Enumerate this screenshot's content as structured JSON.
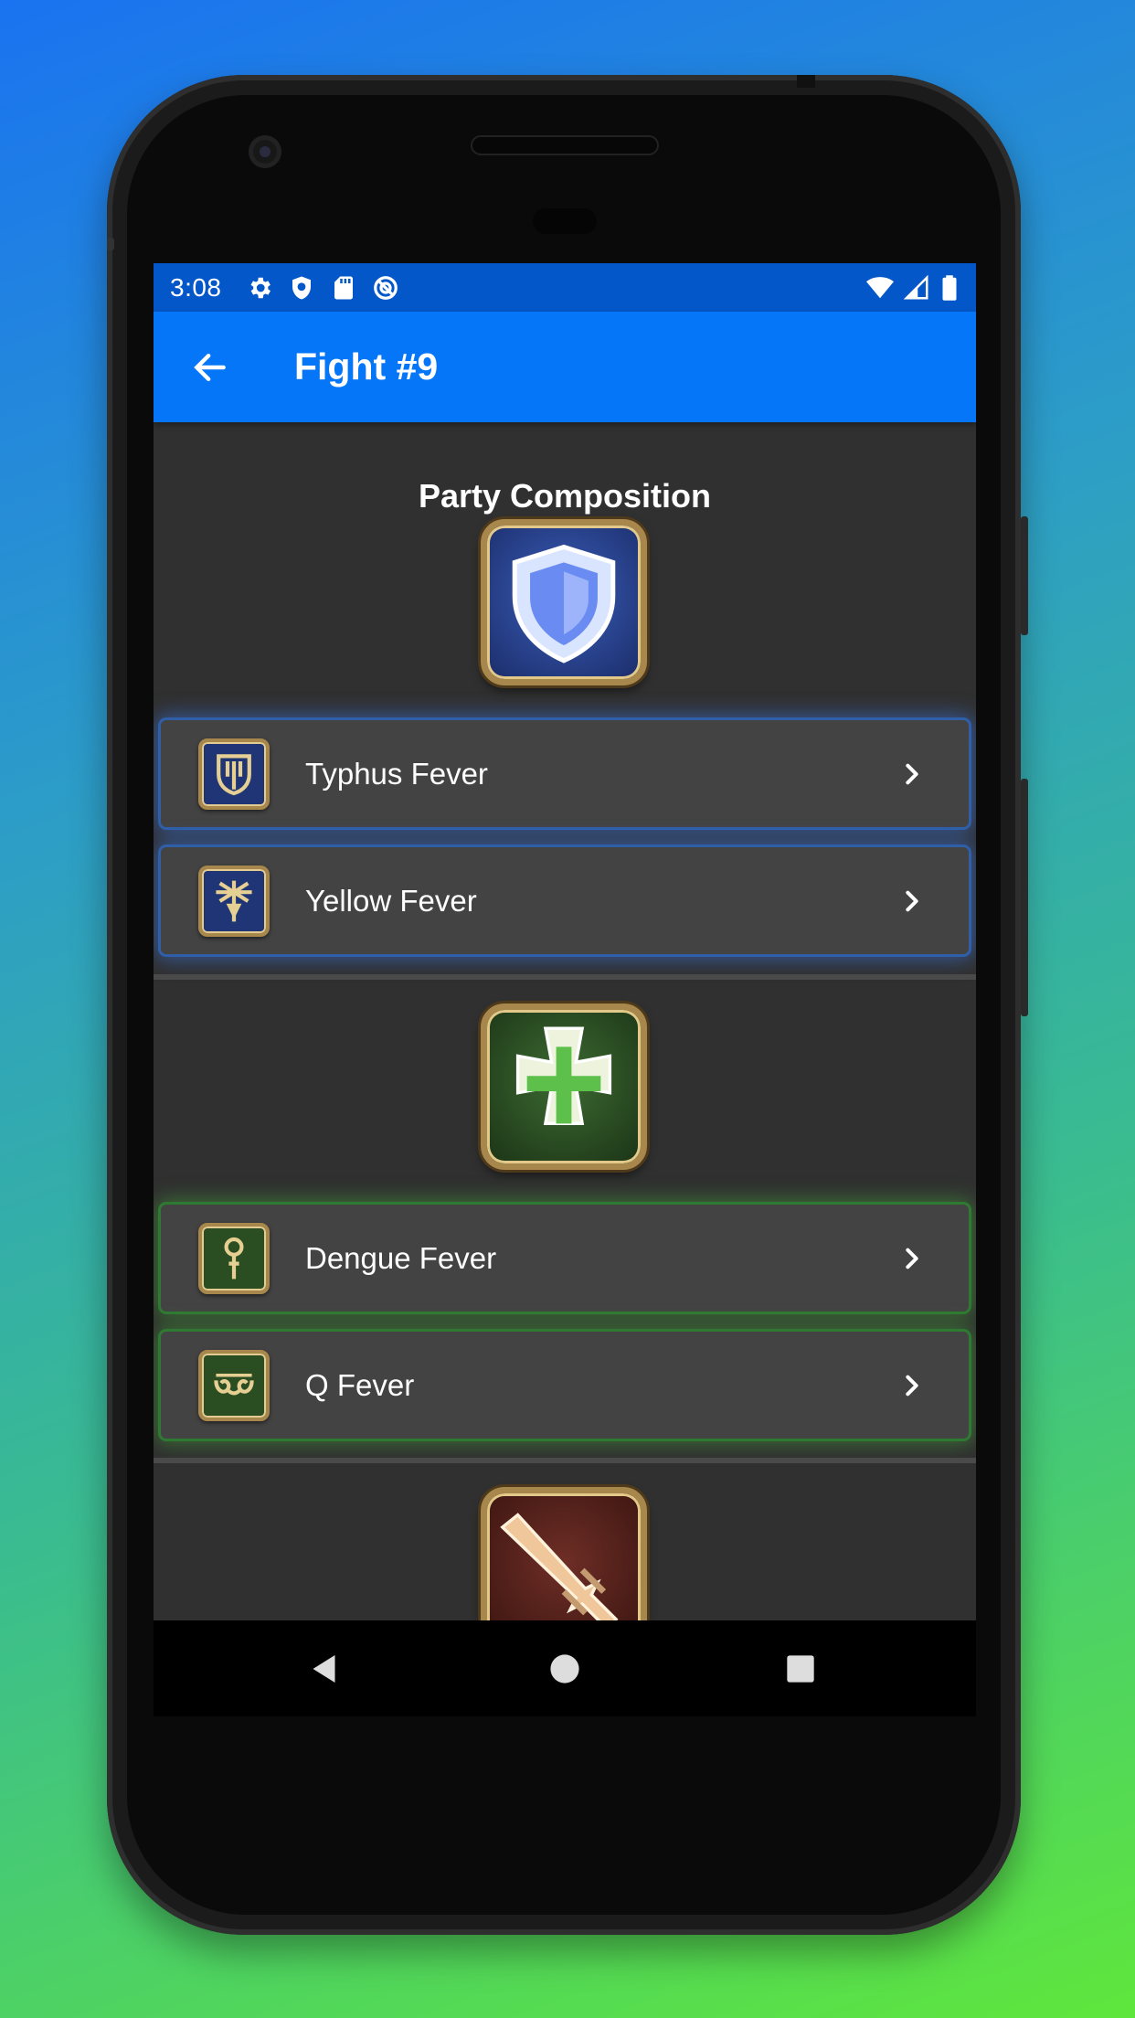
{
  "status_bar": {
    "time": "3:08",
    "left_icons": [
      "settings-icon",
      "shield-icon",
      "sd-card-icon",
      "sync-icon"
    ],
    "right_icons": [
      "wifi-icon",
      "cell-signal-icon",
      "battery-icon"
    ]
  },
  "app_bar": {
    "title": "Fight #9",
    "back_icon": "arrow-back-icon"
  },
  "section_title": "Party Composition",
  "roles": [
    {
      "role": "tank",
      "role_icon": "shield-role-icon",
      "color": "#2f5fa8",
      "members": [
        {
          "label": "Typhus Fever",
          "job_icon": "paladin-icon"
        },
        {
          "label": "Yellow Fever",
          "job_icon": "dark-knight-icon"
        }
      ]
    },
    {
      "role": "healer",
      "role_icon": "cross-role-icon",
      "color": "#2f7a32",
      "members": [
        {
          "label": "Dengue Fever",
          "job_icon": "white-mage-icon"
        },
        {
          "label": "Q Fever",
          "job_icon": "scholar-icon"
        }
      ]
    },
    {
      "role": "dps",
      "role_icon": "sword-role-icon",
      "color": "#6a2a22",
      "members": []
    }
  ],
  "nav_bar": {
    "buttons": [
      "nav-back-icon",
      "nav-home-icon",
      "nav-recents-icon"
    ]
  }
}
